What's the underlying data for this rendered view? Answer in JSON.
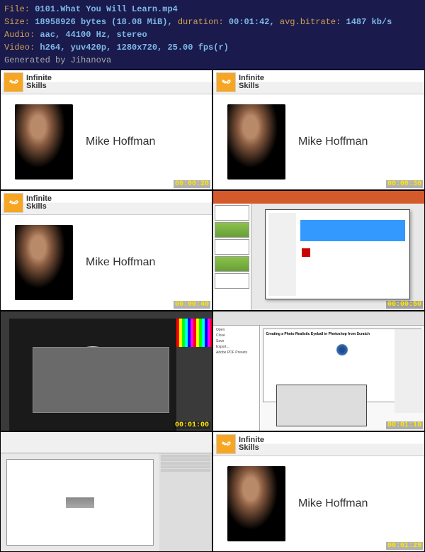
{
  "info": {
    "file_label": "File:",
    "file_value": "0101.What You Will Learn.mp4",
    "size_label": "Size:",
    "size_value": "18958926 bytes (18.08 MiB),",
    "duration_label": "duration:",
    "duration_value": "00:01:42,",
    "bitrate_label": "avg.bitrate:",
    "bitrate_value": "1487 kb/s",
    "audio_label": "Audio:",
    "audio_value": "aac, 44100 Hz, stereo",
    "video_label": "Video:",
    "video_value": "h264, yuv420p, 1280x720, 25.00 fps(r)",
    "generated": "Generated by Jihanova"
  },
  "logo": {
    "line1": "Infinite",
    "line2": "Skills"
  },
  "presenter": {
    "name": "Mike Hoffman"
  },
  "timestamps": {
    "t1": "00:00:20",
    "t2": "00:00:30",
    "t3": "00:00:40",
    "t4": "00:00:50",
    "t5": "00:01:00",
    "t6": "00:01:10",
    "t7": "",
    "t8": "00:01:29"
  },
  "indesign": {
    "title": "Creating a Photo Realistic Eyeball in Photoshop from Scratch"
  }
}
